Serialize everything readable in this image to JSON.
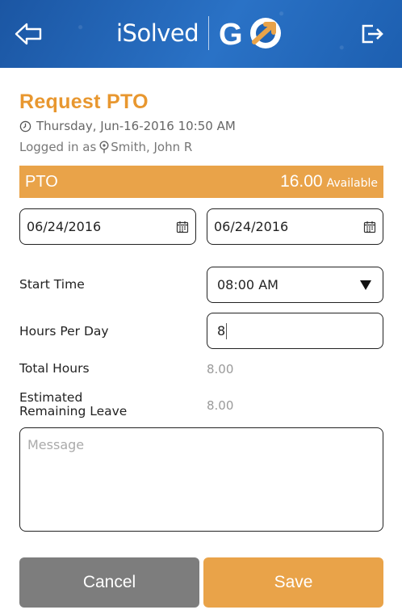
{
  "header": {
    "brand": "iSolved",
    "logo_text": "GO",
    "back_icon": "back-arrow-icon",
    "logout_icon": "logout-icon",
    "accent": "#1f63b6"
  },
  "page": {
    "title": "Request PTO",
    "datetime": "Thursday, Jun-16-2016 10:50 AM",
    "logged_in_prefix": "Logged in as",
    "user": "Smith, John R"
  },
  "pto": {
    "type": "PTO",
    "amount": "16.00",
    "available_label": "Available",
    "color": "#e9a349"
  },
  "dates": {
    "start": "06/24/2016",
    "end": "06/24/2016"
  },
  "form": {
    "start_time_label": "Start Time",
    "start_time_value": "08:00 AM",
    "hours_per_day_label": "Hours Per Day",
    "hours_per_day_value": "8",
    "total_hours_label": "Total Hours",
    "total_hours_value": "8.00",
    "est_label_line1": "Estimated",
    "est_label_line2": "Remaining Leave",
    "est_value": "8.00",
    "message_placeholder": "Message"
  },
  "actions": {
    "cancel": "Cancel",
    "save": "Save"
  }
}
